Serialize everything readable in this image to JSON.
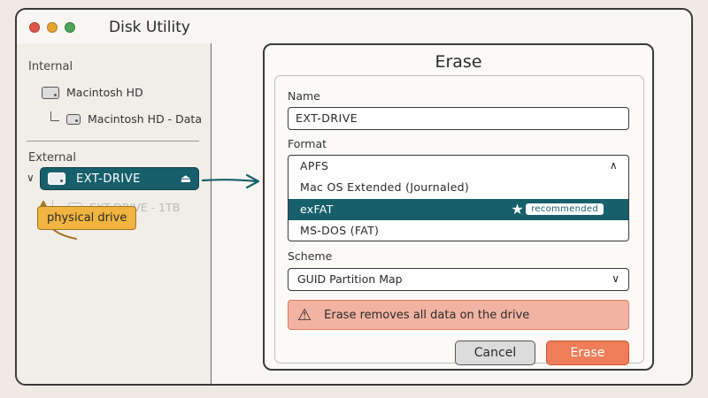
{
  "window": {
    "title": "Disk Utility"
  },
  "sidebar": {
    "internal_label": "Internal",
    "internal_items": [
      {
        "label": "Macintosh HD",
        "icon": "hard-drive-icon"
      },
      {
        "label": "Macintosh HD - Data",
        "icon": "hard-drive-icon"
      }
    ],
    "external_label": "External",
    "external_items": [
      {
        "label": "EXT-DRIVE",
        "icon": "hard-drive-icon",
        "selected": true,
        "eject_icon": "eject-icon"
      },
      {
        "label": "EXT-DRIVE - 1TB",
        "icon": "hard-drive-icon",
        "dimmed": true
      }
    ]
  },
  "callout": {
    "label": "physical drive"
  },
  "dialog": {
    "title": "Erase",
    "name_label": "Name",
    "name_value": "EXT-DRIVE",
    "format_label": "Format",
    "format_options": [
      "APFS",
      "Mac OS Extended (Journaled)",
      "exFAT",
      "MS-DOS (FAT)"
    ],
    "format_selected": "exFAT",
    "recommended_badge": "recommended",
    "scheme_label": "Scheme",
    "scheme_value": "GUID Partition Map",
    "warning_text": "Erase removes all data on the drive",
    "cancel_label": "Cancel",
    "erase_label": "Erase"
  },
  "colors": {
    "accent": "#185f6c",
    "callout": "#f2b440",
    "warning_bg": "#f3b3a2",
    "erase_button": "#ee7d58"
  }
}
